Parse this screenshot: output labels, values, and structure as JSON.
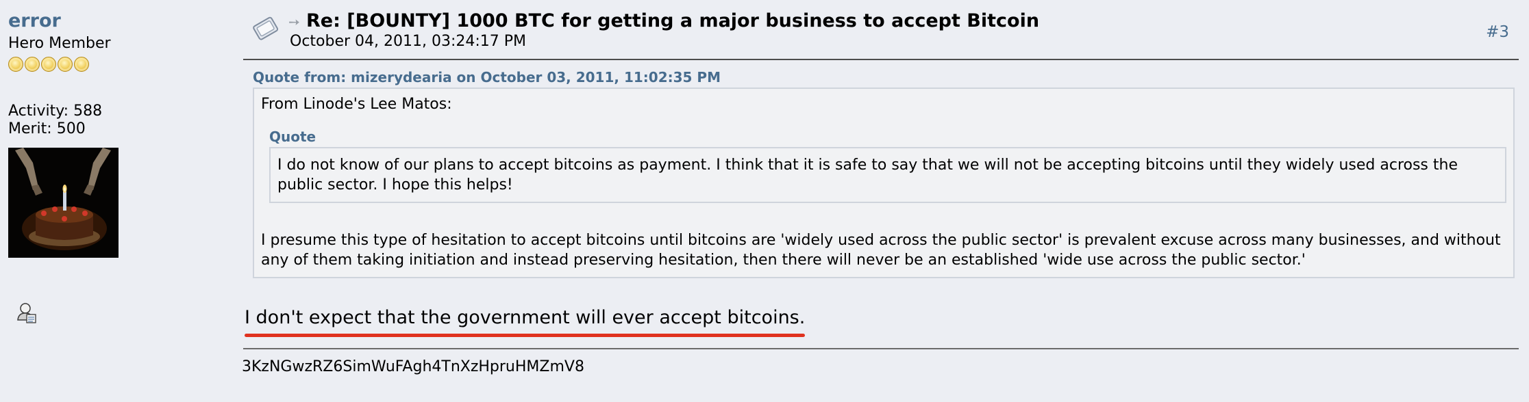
{
  "poster": {
    "name": "error",
    "rank": "Hero Member",
    "stars": 5,
    "activity": "Activity: 588",
    "merit": "Merit: 500",
    "avatar_icon": "portal-cake-avatar",
    "profile_icon": "user-profile-icon"
  },
  "post": {
    "reply_icon": "topic-icon",
    "title": "Re: [BOUNTY] 1000 BTC for getting a major business to accept Bitcoin",
    "date": "October 04, 2011, 03:24:17 PM",
    "number": "#3",
    "quote": {
      "header": "Quote from: mizerydearia on October 03, 2011, 11:02:35 PM",
      "intro": "From Linode's Lee Matos:",
      "inner_header": "Quote",
      "inner_text": "I do not know of our plans to accept bitcoins as payment. I think that it is safe to say that we will not be accepting bitcoins until they widely used across the public sector. I hope this helps!",
      "tail": "I presume this type of hesitation to accept bitcoins until bitcoins are 'widely used across the public sector' is prevalent excuse across many businesses, and without any of them taking initiation and instead preserving hesitation, then there will never be an established 'wide use across the public sector.'"
    },
    "body": "I don't expect that the government will ever accept bitcoins.",
    "signature": "3KzNGwzRZ6SimWuFAgh4TnXzHpruHMZmV8"
  },
  "colors": {
    "background": "#eceef3",
    "link": "#476c8e",
    "highlight_underline": "#e0321f"
  }
}
